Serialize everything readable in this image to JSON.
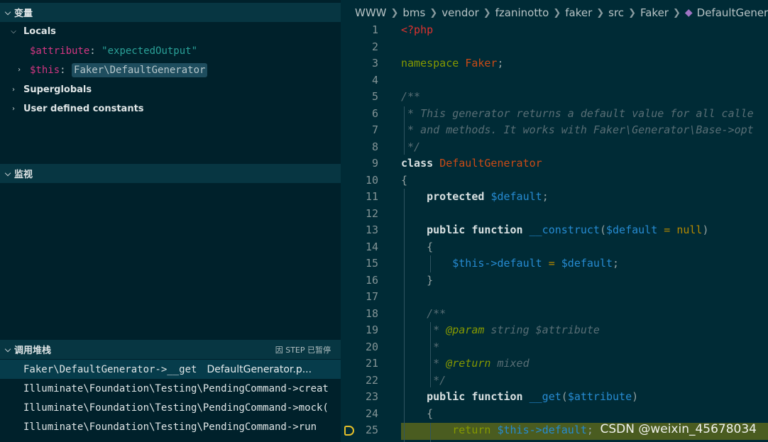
{
  "sidebar": {
    "variables_header": "变量",
    "locals_label": "Locals",
    "locals_vars": {
      "attribute_name": "$attribute",
      "attribute_value": "\"expectedOutput\"",
      "this_name": "$this",
      "this_value": "Faker\\DefaultGenerator"
    },
    "superglobals_label": "Superglobals",
    "user_constants_label": "User defined constants",
    "watch_header": "监视",
    "callstack_header": "调用堆栈",
    "callstack_status": "因 STEP 已暂停",
    "frames": [
      {
        "fn": "Faker\\DefaultGenerator->__get",
        "file": "DefaultGenerator.p..."
      },
      {
        "fn": "Illuminate\\Foundation\\Testing\\PendingCommand->creat",
        "file": ""
      },
      {
        "fn": "Illuminate\\Foundation\\Testing\\PendingCommand->mock(",
        "file": ""
      },
      {
        "fn": "Illuminate\\Foundation\\Testing\\PendingCommand->run",
        "file": ""
      }
    ]
  },
  "breadcrumb": [
    "WWW",
    "bms",
    "vendor",
    "fzaninotto",
    "faker",
    "src",
    "Faker",
    "DefaultGenerator."
  ],
  "editor": {
    "line_numbers": [
      "1",
      "2",
      "3",
      "4",
      "5",
      "6",
      "7",
      "8",
      "9",
      "10",
      "11",
      "12",
      "13",
      "14",
      "15",
      "16",
      "17",
      "18",
      "19",
      "20",
      "21",
      "22",
      "23",
      "24",
      "25"
    ],
    "current_line": 25,
    "code": {
      "l1": "<?php",
      "l3_kw": "namespace",
      "l3_name": "Faker",
      "l3_end": ";",
      "l5": "/**",
      "l6": " * This generator returns a default value for all calle",
      "l7": " * and methods. It works with Faker\\Generator\\Base->opt",
      "l8": " */",
      "l9_kw": "class",
      "l9_name": "DefaultGenerator",
      "l10": "{",
      "l11_kw": "protected",
      "l11_var": "$default",
      "l11_end": ";",
      "l13_kw1": "public",
      "l13_kw2": "function",
      "l13_fn": "__construct",
      "l13_paren": "(",
      "l13_var": "$default",
      "l13_eq": " = ",
      "l13_null": "null",
      "l13_end": ")",
      "l14": "{",
      "l15_this": "$this",
      "l15_arrow": "->",
      "l15_prop": "default",
      "l15_eq": " = ",
      "l15_var": "$default",
      "l15_end": ";",
      "l16": "}",
      "l18": "/**",
      "l19_star": " * ",
      "l19_ann": "@param",
      "l19_rest": " string $attribute",
      "l20": " *",
      "l21_star": " * ",
      "l21_ann": "@return",
      "l21_rest": " mixed",
      "l22": " */",
      "l23_kw1": "public",
      "l23_kw2": "function",
      "l23_fn": "__get",
      "l23_paren": "(",
      "l23_var": "$attribute",
      "l23_end": ")",
      "l24": "{",
      "l25_kw": "return",
      "l25_this": "$this",
      "l25_arrow": "->",
      "l25_prop": "default",
      "l25_end": ";"
    }
  },
  "watermark": "CSDN @weixin_45678034"
}
